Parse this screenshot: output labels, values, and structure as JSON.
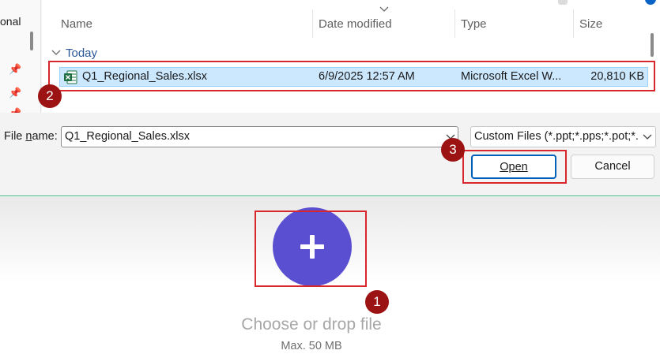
{
  "dialog": {
    "nav": {
      "item_label": "onal"
    },
    "columns": {
      "name": "Name",
      "date": "Date modified",
      "type": "Type",
      "size": "Size"
    },
    "group": "Today",
    "file": {
      "name": "Q1_Regional_Sales.xlsx",
      "date": "6/9/2025 12:57 AM",
      "type": "Microsoft Excel W...",
      "size": "20,810 KB"
    },
    "filename_label_prefix": "File ",
    "filename_label_accel": "n",
    "filename_label_suffix": "ame:",
    "filename_value": "Q1_Regional_Sales.xlsx",
    "filter_value": "Custom Files (*.ppt;*.pps;*.pot;*.",
    "open_label": "Open",
    "cancel_label": "Cancel"
  },
  "upload": {
    "drop_text": "Choose or drop file",
    "max_text": "Max. 50 MB"
  },
  "annotations": {
    "badge_1": "1",
    "badge_2": "2",
    "badge_3": "3"
  },
  "colors": {
    "highlight": "#d9262c",
    "badge": "#9c1313",
    "accent_circle": "#5b4fd1",
    "selection": "#cce8ff"
  }
}
